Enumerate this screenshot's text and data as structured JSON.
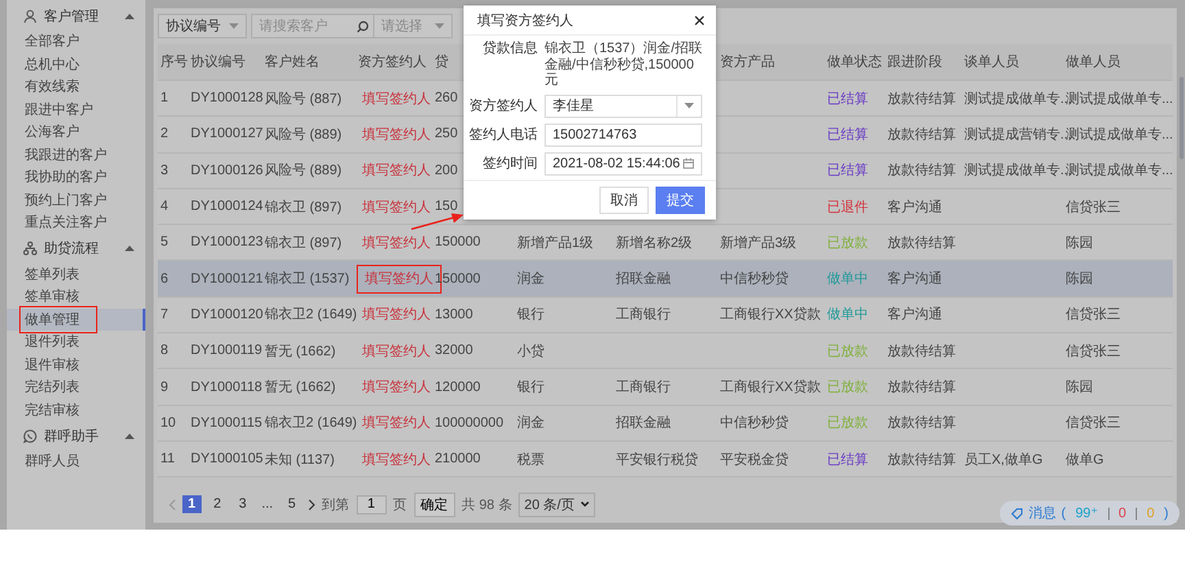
{
  "sidebar": {
    "groups": [
      {
        "title": "客户管理",
        "expanded": true,
        "items": [
          {
            "label": "全部客户",
            "selected": false,
            "boxed": false
          },
          {
            "label": "总机中心",
            "selected": false,
            "boxed": false
          },
          {
            "label": "有效线索",
            "selected": false,
            "boxed": false
          },
          {
            "label": "跟进中客户",
            "selected": false,
            "boxed": false
          },
          {
            "label": "公海客户",
            "selected": false,
            "boxed": false
          },
          {
            "label": "我跟进的客户",
            "selected": false,
            "boxed": false
          },
          {
            "label": "我协助的客户",
            "selected": false,
            "boxed": false
          },
          {
            "label": "预约上门客户",
            "selected": false,
            "boxed": false
          },
          {
            "label": "重点关注客户",
            "selected": false,
            "boxed": false
          }
        ]
      },
      {
        "title": "助贷流程",
        "expanded": true,
        "items": [
          {
            "label": "签单列表",
            "selected": false,
            "boxed": false
          },
          {
            "label": "签单审核",
            "selected": false,
            "boxed": false
          },
          {
            "label": "做单管理",
            "selected": true,
            "boxed": true
          },
          {
            "label": "退件列表",
            "selected": false,
            "boxed": false
          },
          {
            "label": "退件审核",
            "selected": false,
            "boxed": false
          },
          {
            "label": "完结列表",
            "selected": false,
            "boxed": false
          },
          {
            "label": "完结审核",
            "selected": false,
            "boxed": false
          }
        ]
      },
      {
        "title": "群呼助手",
        "expanded": true,
        "items": [
          {
            "label": "群呼人员",
            "selected": false,
            "boxed": false
          }
        ]
      }
    ]
  },
  "toolbar": {
    "field_select": {
      "value": "协议编号"
    },
    "search": {
      "placeholder": "请搜索客户"
    },
    "filter_select": {
      "placeholder": "请选择"
    }
  },
  "table": {
    "columns": {
      "index": "序号",
      "agreement_no": "协议编号",
      "customer": "客户姓名",
      "signer": "资方签约人",
      "column_5": "贷",
      "product": "资方产品",
      "status": "做单状态",
      "stage": "跟进阶段",
      "negotiator": "谈单人员",
      "handler": "做单人员"
    },
    "rows": [
      {
        "selected": false,
        "signer_boxed": false,
        "color": "#6a3cc4",
        "cells": {
          "index": "1",
          "agreement_no": "DY1000128",
          "customer": "风险号 (887)",
          "signer": "填写签约人",
          "column_5": "260",
          "status": "已结算",
          "stage": "放款待结算",
          "negotiator": "测试提成做单专...",
          "handler": "测试提成做单专..."
        }
      },
      {
        "selected": false,
        "signer_boxed": false,
        "color": "#6a3cc4",
        "cells": {
          "index": "2",
          "agreement_no": "DY1000127",
          "customer": "风险号 (889)",
          "signer": "填写签约人",
          "column_5": "250",
          "status": "已结算",
          "stage": "放款待结算",
          "negotiator": "测试提成营销专...",
          "handler": "测试提成做单专..."
        }
      },
      {
        "selected": false,
        "signer_boxed": false,
        "color": "#6a3cc4",
        "cells": {
          "index": "3",
          "agreement_no": "DY1000126",
          "customer": "风险号 (889)",
          "signer": "填写签约人",
          "column_5": "200",
          "status": "已结算",
          "stage": "放款待结算",
          "negotiator": "测试提成做单专...",
          "handler": "测试提成做单专..."
        }
      },
      {
        "selected": false,
        "signer_boxed": false,
        "color": "#d2333c",
        "cells": {
          "index": "4",
          "agreement_no": "DY1000124",
          "customer": "锦衣卫 (897)",
          "signer": "填写签约人",
          "column_5": "150",
          "status": "已退件",
          "stage": "客户沟通",
          "handler": "信贷张三"
        }
      },
      {
        "selected": false,
        "signer_boxed": false,
        "color": "#7fb03a",
        "cells": {
          "index": "5",
          "agreement_no": "DY1000123",
          "customer": "锦衣卫 (897)",
          "signer": "填写签约人",
          "column_5": "150000",
          "column_6": "新增产品1级",
          "column_7": "新增名称2级",
          "product": "新增产品3级",
          "status": "已放款",
          "stage": "放款待结算",
          "handler": "陈园"
        }
      },
      {
        "selected": true,
        "signer_boxed": true,
        "color": "#1f9a9a",
        "cells": {
          "index": "6",
          "agreement_no": "DY1000121",
          "customer": "锦衣卫 (1537)",
          "signer": "填写签约人",
          "column_5": "150000",
          "column_6": "润金",
          "column_7": "招联金融",
          "product": "中信秒秒贷",
          "status": "做单中",
          "stage": "客户沟通",
          "handler": "陈园"
        }
      },
      {
        "selected": false,
        "signer_boxed": false,
        "color": "#1f9a9a",
        "cells": {
          "index": "7",
          "agreement_no": "DY1000120",
          "customer": "锦衣卫2 (1649)",
          "signer": "填写签约人",
          "column_5": "13000",
          "column_6": "银行",
          "column_7": "工商银行",
          "product": "工商银行XX贷款",
          "status": "做单中",
          "stage": "客户沟通",
          "handler": "信贷张三"
        }
      },
      {
        "selected": false,
        "signer_boxed": false,
        "color": "#7fb03a",
        "cells": {
          "index": "8",
          "agreement_no": "DY1000119",
          "customer": "暂无 (1662)",
          "signer": "填写签约人",
          "column_5": "32000",
          "column_6": "小贷",
          "status": "已放款",
          "stage": "放款待结算",
          "handler": "信贷张三"
        }
      },
      {
        "selected": false,
        "signer_boxed": false,
        "color": "#7fb03a",
        "cells": {
          "index": "9",
          "agreement_no": "DY1000118",
          "customer": "暂无 (1662)",
          "signer": "填写签约人",
          "column_5": "120000",
          "column_6": "银行",
          "column_7": "工商银行",
          "product": "工商银行XX贷款",
          "status": "已放款",
          "stage": "放款待结算",
          "handler": "陈园"
        }
      },
      {
        "selected": false,
        "signer_boxed": false,
        "color": "#7fb03a",
        "cells": {
          "index": "10",
          "agreement_no": "DY1000115",
          "customer": "锦衣卫2 (1649)",
          "signer": "填写签约人",
          "column_5": "100000000",
          "column_6": "润金",
          "column_7": "招联金融",
          "product": "中信秒秒贷",
          "status": "已放款",
          "stage": "放款待结算",
          "handler": "信贷张三"
        }
      },
      {
        "selected": false,
        "signer_boxed": false,
        "color": "#6a3cc4",
        "cells": {
          "index": "11",
          "agreement_no": "DY1000105",
          "customer": "未知 (1137)",
          "signer": "填写签约人",
          "column_5": "210000",
          "column_6": "税票",
          "column_7": "平安银行税贷",
          "product": "平安税金贷",
          "status": "已结算",
          "stage": "放款待结算",
          "negotiator": "员工X,做单G",
          "handler": "做单G"
        }
      }
    ]
  },
  "pagination": {
    "pages": [
      {
        "label": "1",
        "kind": "page",
        "selected": true
      },
      {
        "label": "2",
        "kind": "page",
        "selected": false
      },
      {
        "label": "3",
        "kind": "page",
        "selected": false
      },
      {
        "label": "...",
        "kind": "ellipsis",
        "selected": false
      },
      {
        "label": "5",
        "kind": "page",
        "selected": false
      }
    ],
    "jump_label": "到第",
    "jump_value": "1",
    "page_unit": "页",
    "confirm": "确定",
    "total": "共 98 条",
    "page_size": "20 条/页"
  },
  "messages": {
    "label": "消息",
    "open": "(",
    "close": ")",
    "counts": [
      {
        "value": "99⁺",
        "color": "#1aa3c9"
      },
      {
        "value": "0",
        "color": "#d9434b"
      },
      {
        "value": "0",
        "color": "#e0a020"
      }
    ]
  },
  "dialog": {
    "title": "填写资方签约人",
    "fields": [
      {
        "kind": "text",
        "label": "贷款信息",
        "value": "锦衣卫（1537）润金/招联金融/中信秒秒贷,150000元"
      },
      {
        "kind": "select",
        "label": "资方签约人",
        "value": "李佳星"
      },
      {
        "kind": "input",
        "label": "签约人电话",
        "value": "15002714763"
      },
      {
        "kind": "date",
        "label": "签约时间",
        "value": "2021-08-02 15:44:06"
      }
    ],
    "buttons": [
      {
        "label": "取消",
        "kind": "default"
      },
      {
        "label": "提交",
        "kind": "primary"
      }
    ]
  }
}
